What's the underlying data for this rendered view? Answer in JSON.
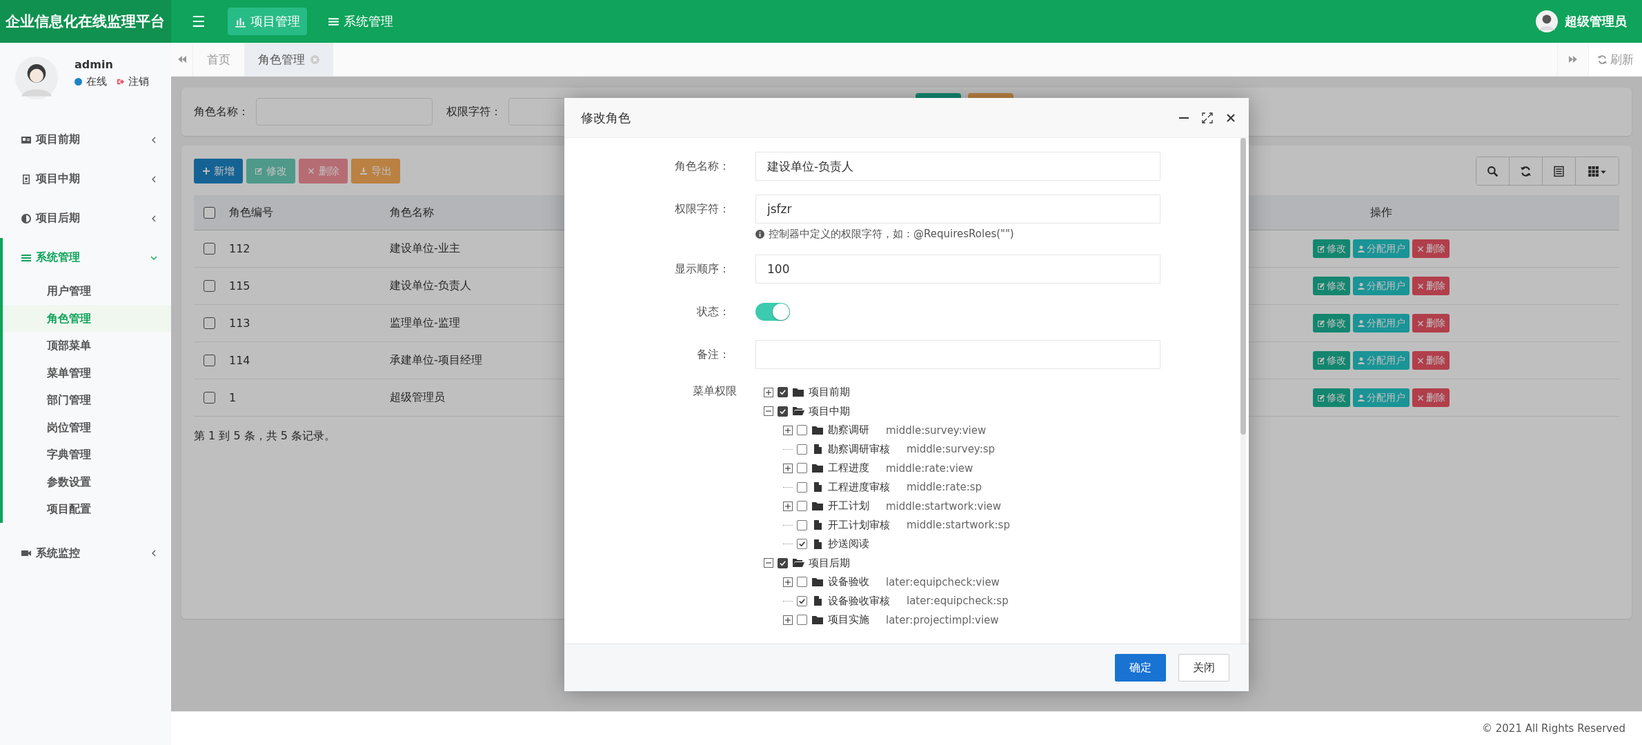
{
  "header": {
    "logo": "企业信息化在线监理平台",
    "menu_icon": "☰",
    "top_menu": [
      {
        "label": "项目管理",
        "selected": true
      },
      {
        "label": "系统管理",
        "selected": false
      }
    ],
    "user": "超级管理员"
  },
  "sidebar": {
    "user": {
      "name": "admin",
      "status": "在线",
      "logout": "注销"
    },
    "items": [
      {
        "label": "项目前期",
        "active": false,
        "expanded": false
      },
      {
        "label": "项目中期",
        "active": false,
        "expanded": false
      },
      {
        "label": "项目后期",
        "active": false,
        "expanded": false
      },
      {
        "label": "系统管理",
        "active": true,
        "expanded": true,
        "children": [
          {
            "label": "用户管理",
            "selected": false
          },
          {
            "label": "角色管理",
            "selected": true
          },
          {
            "label": "顶部菜单",
            "selected": false
          },
          {
            "label": "菜单管理",
            "selected": false
          },
          {
            "label": "部门管理",
            "selected": false
          },
          {
            "label": "岗位管理",
            "selected": false
          },
          {
            "label": "字典管理",
            "selected": false
          },
          {
            "label": "参数设置",
            "selected": false
          },
          {
            "label": "项目配置",
            "selected": false
          }
        ]
      },
      {
        "label": "系统监控",
        "active": false,
        "expanded": false
      }
    ]
  },
  "tabs": [
    {
      "label": "首页",
      "selected": false,
      "closable": false
    },
    {
      "label": "角色管理",
      "selected": true,
      "closable": true
    }
  ],
  "refresh": "刷新",
  "search_form": {
    "fields": [
      {
        "label": "角色名称："
      },
      {
        "label": "权限字符："
      }
    ]
  },
  "toolbar": [
    {
      "label": "新增",
      "kind": "add",
      "disabled": false
    },
    {
      "label": "修改",
      "kind": "edit",
      "disabled": true
    },
    {
      "label": "删除",
      "kind": "delete",
      "disabled": true
    },
    {
      "label": "导出",
      "kind": "export",
      "disabled": false
    }
  ],
  "table": {
    "header_checked": false,
    "columns": [
      "角色编号",
      "角色名称",
      "操作"
    ],
    "rows": [
      {
        "id": "112",
        "name": "建设单位-业主",
        "checked": false,
        "actions": [
          "修改",
          "分配用户",
          "删除"
        ]
      },
      {
        "id": "115",
        "name": "建设单位-负责人",
        "checked": false,
        "actions": [
          "修改",
          "分配用户",
          "删除"
        ]
      },
      {
        "id": "113",
        "name": "监理单位-监理",
        "checked": false,
        "actions": [
          "修改",
          "分配用户",
          "删除"
        ]
      },
      {
        "id": "114",
        "name": "承建单位-项目经理",
        "checked": false,
        "actions": [
          "修改",
          "分配用户",
          "删除"
        ]
      },
      {
        "id": "1",
        "name": "超级管理员",
        "checked": false,
        "actions": [
          "修改",
          "分配用户",
          "删除"
        ]
      }
    ]
  },
  "pagination": "第 1 到 5 条，共 5 条记录。",
  "footer": "© 2021 All Rights Reserved",
  "modal": {
    "title": "修改角色",
    "fields": [
      {
        "label": "角色名称：",
        "value": "建设单位-负责人"
      },
      {
        "label": "权限字符：",
        "value": "jsfzr",
        "hint": "控制器中定义的权限字符，如：@RequiresRoles(\"\")"
      },
      {
        "label": "显示顺序：",
        "value": "100"
      }
    ],
    "status": {
      "label": "状态：",
      "on": true
    },
    "remark": {
      "label": "备注："
    },
    "tree_label": "菜单权限",
    "tree": [
      {
        "label": "项目前期",
        "kind": "folder",
        "expanded": false,
        "checked": true
      },
      {
        "label": "项目中期",
        "kind": "folder",
        "expanded": true,
        "checked": true,
        "children": [
          {
            "label": "勘察调研",
            "perm": "middle:survey:view",
            "kind": "folder",
            "expanded": false,
            "checked": false
          },
          {
            "label": "勘察调研审核",
            "perm": "middle:survey:sp",
            "kind": "file",
            "checked": false
          },
          {
            "label": "工程进度",
            "perm": "middle:rate:view",
            "kind": "folder",
            "expanded": false,
            "checked": false
          },
          {
            "label": "工程进度审核",
            "perm": "middle:rate:sp",
            "kind": "file",
            "checked": false
          },
          {
            "label": "开工计划",
            "perm": "middle:startwork:view",
            "kind": "folder",
            "expanded": false,
            "checked": false
          },
          {
            "label": "开工计划审核",
            "perm": "middle:startwork:sp",
            "kind": "file",
            "checked": false
          },
          {
            "label": "抄送阅读",
            "kind": "file",
            "checked": true
          }
        ]
      },
      {
        "label": "项目后期",
        "kind": "folder",
        "expanded": true,
        "checked": true,
        "children": [
          {
            "label": "设备验收",
            "perm": "later:equipcheck:view",
            "kind": "folder",
            "expanded": false,
            "checked": false
          },
          {
            "label": "设备验收审核",
            "perm": "later:equipcheck:sp",
            "kind": "file",
            "checked": true
          },
          {
            "label": "项目实施",
            "perm": "later:projectimpl:view",
            "kind": "folder",
            "expanded": false,
            "checked": false
          }
        ]
      }
    ],
    "buttons": [
      {
        "label": "确定",
        "kind": "primary"
      },
      {
        "label": "关闭",
        "kind": "default"
      }
    ]
  }
}
